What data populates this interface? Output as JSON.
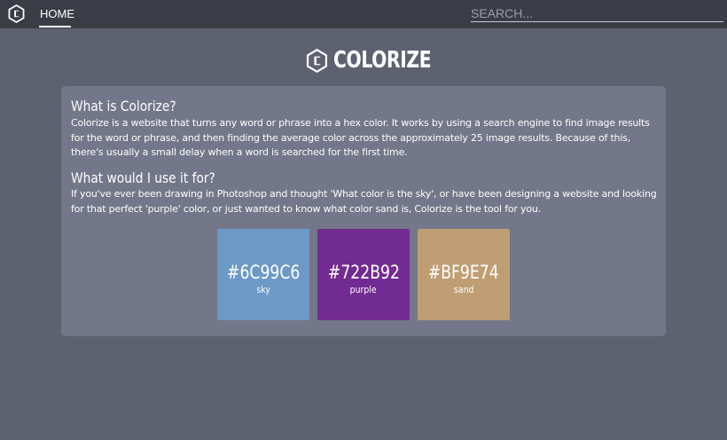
{
  "nav": {
    "home_label": "HOME"
  },
  "search": {
    "placeholder": "SEARCH..."
  },
  "brand": {
    "title": "COLORIZE",
    "icon": "hexagon-c-logo-icon"
  },
  "about": {
    "heading": "What is Colorize?",
    "text": "Colorize is a website that turns any word or phrase into a hex color. It works by using a search engine to find image results for the word or phrase, and then finding the average color across the approximately 25 image results. Because of this, there's usually a small delay when a word is searched for the first time."
  },
  "usage": {
    "heading": "What would I use it for?",
    "text": "If you've ever been drawing in Photoshop and thought 'What color is the sky', or have been designing a website and looking for that perfect 'purple' color, or just wanted to know what color sand is, Colorize is the tool for you."
  },
  "examples": [
    {
      "hex": "#6C99C6",
      "word": "sky",
      "color": "#6C99C6"
    },
    {
      "hex": "#722B92",
      "word": "purple",
      "color": "#722B92"
    },
    {
      "hex": "#BF9E74",
      "word": "sand",
      "color": "#BF9E74"
    }
  ],
  "colors": {
    "topbar": "#3a3d46",
    "background": "#5e6270",
    "panel": "#737789"
  }
}
